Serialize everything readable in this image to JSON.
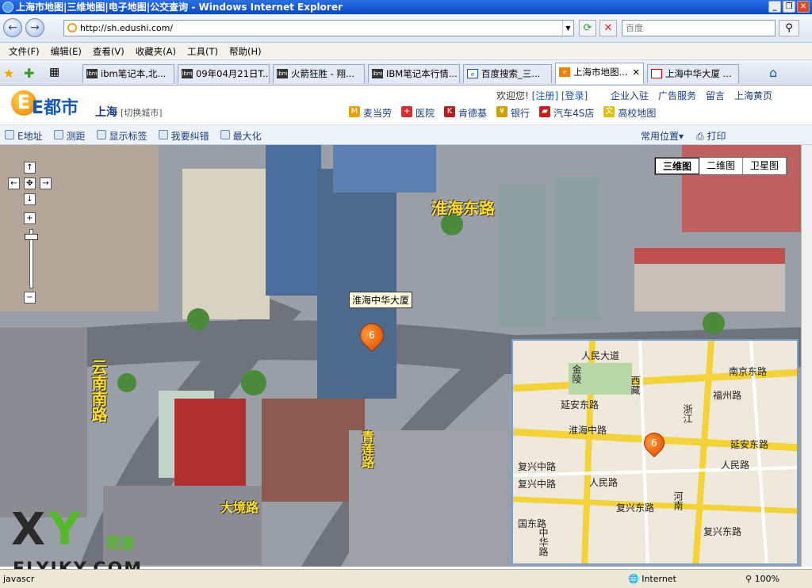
{
  "window": {
    "title": "上海市地图|三维地图|电子地图|公交查询 - Windows Internet Explorer"
  },
  "address": {
    "url": "http://sh.edushi.com/",
    "search_placeholder": "百度"
  },
  "menu": [
    "文件(F)",
    "编辑(E)",
    "查看(V)",
    "收藏夹(A)",
    "工具(T)",
    "帮助(H)"
  ],
  "tabs": [
    {
      "label": "ibm笔记本,北..."
    },
    {
      "label": "09年04月21日T..."
    },
    {
      "label": "火箭狂胜 - 翔..."
    },
    {
      "label": "IBM笔记本行情..."
    },
    {
      "label": "百度搜索_三..."
    },
    {
      "label": "上海市地图...",
      "close": "✕"
    },
    {
      "label": "上海中华大厦 ..."
    }
  ],
  "site": {
    "logo_e": "E",
    "logo_text": "E都市",
    "city": "上海",
    "switch_city": "[切换城市]",
    "welcome": "欢迎您!",
    "register": "[注册]",
    "login": "[登录]",
    "links": [
      "企业入驻",
      "广告服务",
      "留言",
      "上海黄页"
    ],
    "categories": [
      "麦当劳",
      "医院",
      "肯德基",
      "银行",
      "汽车4S店",
      "高校地图"
    ]
  },
  "toolbar": {
    "left": [
      "E地址",
      "测距",
      "显示标签",
      "我要纠错",
      "最大化"
    ],
    "common_location": "常用位置▾",
    "print": "打印"
  },
  "map": {
    "view_tabs": [
      "三维图",
      "二维图",
      "卫星图"
    ],
    "building_label": "淮海中华大厦",
    "marker_number": "6",
    "roads3d": [
      "淮海东路",
      "云南南路",
      "大境路",
      "青莲路"
    ]
  },
  "minimap": {
    "streets": [
      "人民大道",
      "南京东路",
      "福州路",
      "延安东路",
      "淮海中路",
      "延安东路",
      "人民路",
      "复兴中路",
      "复兴东路",
      "复兴东路",
      "国东路",
      "金陵",
      "河南",
      "浙江",
      "西藏",
      "中华路",
      "人民路",
      "复兴中路"
    ]
  },
  "watermark": {
    "x": "X",
    "y": "Y",
    "cn": "翔意",
    "site": "FLYIKY.COM"
  },
  "status": {
    "left": "javascr",
    "zone": "Internet",
    "zoom": "100%"
  },
  "colors": {
    "titlebar": "#0a48c8",
    "accent": "#1a58b0",
    "marker": "#e04a00"
  }
}
